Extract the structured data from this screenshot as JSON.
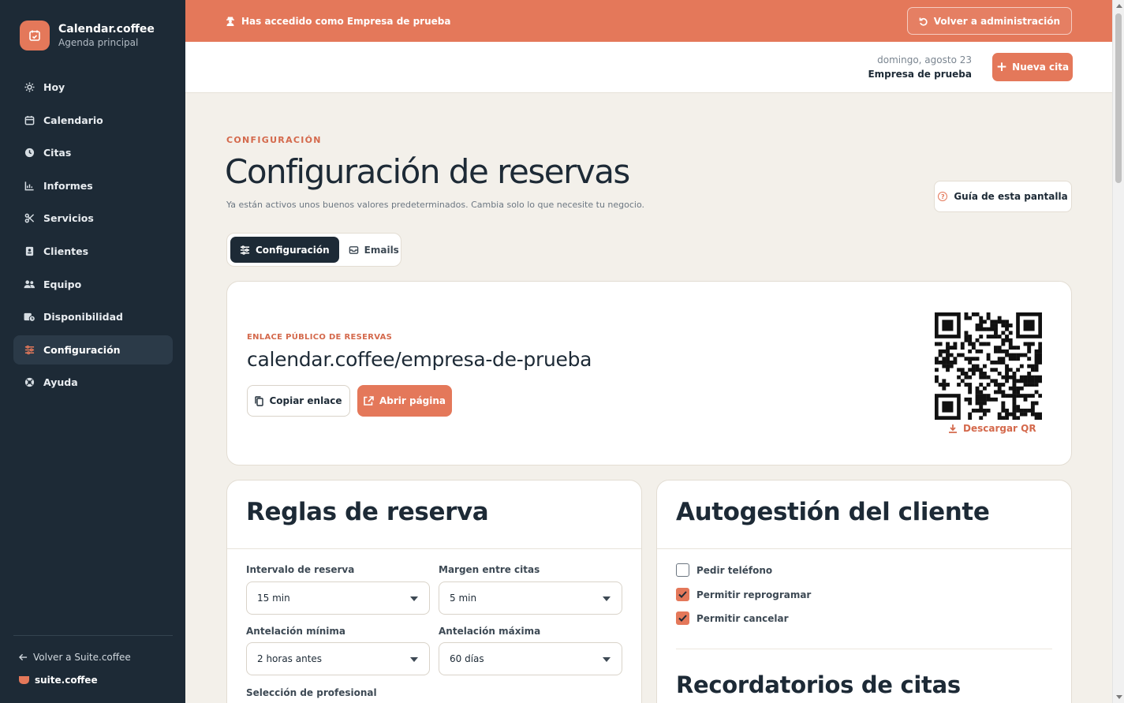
{
  "brand": {
    "name": "Calendar.coffee",
    "subtitle": "Agenda principal",
    "accent_color": "#e4785a"
  },
  "sidebar": {
    "items": [
      {
        "label": "Hoy",
        "icon": "sun-icon",
        "active": false
      },
      {
        "label": "Calendario",
        "icon": "calendar-icon",
        "active": false
      },
      {
        "label": "Citas",
        "icon": "clock-icon",
        "active": false
      },
      {
        "label": "Informes",
        "icon": "chart-icon",
        "active": false
      },
      {
        "label": "Servicios",
        "icon": "scissors-icon",
        "active": false
      },
      {
        "label": "Clientes",
        "icon": "contact-card-icon",
        "active": false
      },
      {
        "label": "Equipo",
        "icon": "users-icon",
        "active": false
      },
      {
        "label": "Disponibilidad",
        "icon": "calendar-clock-icon",
        "active": false
      },
      {
        "label": "Configuración",
        "icon": "sliders-icon",
        "active": true
      },
      {
        "label": "Ayuda",
        "icon": "lifebuoy-icon",
        "active": false
      }
    ],
    "back_label": "Volver a Suite.coffee",
    "suite_label": "suite.coffee"
  },
  "banner": {
    "message": "Has accedido como Empresa de prueba",
    "button_label": "Volver a administración"
  },
  "header": {
    "date": "domingo, agosto 23",
    "company": "Empresa de prueba",
    "new_button": "Nueva cita"
  },
  "page": {
    "eyebrow": "CONFIGURACIÓN",
    "title": "Configuración de reservas",
    "subtitle": "Ya están activos unos buenos valores predeterminados. Cambia solo lo que necesite tu negocio.",
    "guide_button": "Guía de esta pantalla"
  },
  "tabs": [
    {
      "label": "Configuración",
      "active": true
    },
    {
      "label": "Emails",
      "active": false
    }
  ],
  "public_link": {
    "eyebrow": "ENLACE PÚBLICO DE RESERVAS",
    "url": "calendar.coffee/empresa-de-prueba",
    "copy_button": "Copiar enlace",
    "open_button": "Abrir página",
    "download_qr": "Descargar QR"
  },
  "rules": {
    "title": "Reglas de reserva",
    "fields": [
      {
        "label": "Intervalo de reserva",
        "value": "15 min"
      },
      {
        "label": "Margen entre citas",
        "value": "5 min"
      },
      {
        "label": "Antelación mínima",
        "value": "2 horas antes"
      },
      {
        "label": "Antelación máxima",
        "value": "60 días"
      }
    ],
    "next_label": "Selección de profesional"
  },
  "self_service": {
    "title": "Autogestión del cliente",
    "options": [
      {
        "label": "Pedir teléfono",
        "checked": false
      },
      {
        "label": "Permitir reprogramar",
        "checked": true
      },
      {
        "label": "Permitir cancelar",
        "checked": true
      }
    ],
    "reminders_title": "Recordatorios de citas"
  }
}
